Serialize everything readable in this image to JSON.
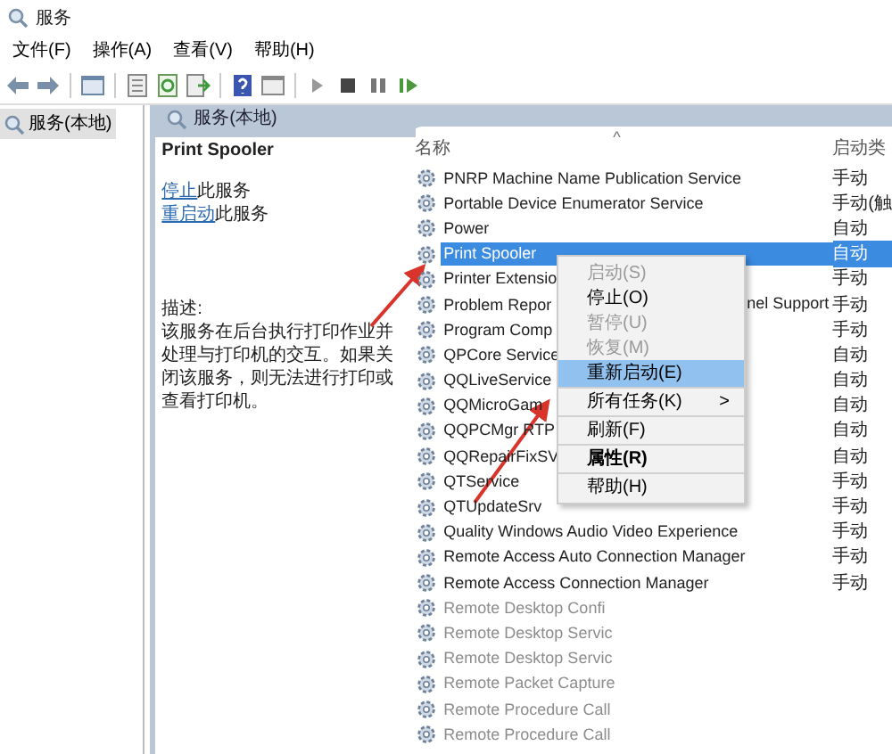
{
  "window": {
    "title": "服务"
  },
  "menu_bar": [
    "文件(F)",
    "操作(A)",
    "查看(V)",
    "帮助(H)"
  ],
  "tree": {
    "items": [
      {
        "label": "服务(本地)",
        "selected": true
      }
    ]
  },
  "panel_header": "服务(本地)",
  "description_pane": {
    "title": "Print Spooler",
    "actions": [
      {
        "link": "停止",
        "text": "此服务"
      },
      {
        "link": "重启动",
        "text": "此服务"
      }
    ],
    "description_label": "描述:",
    "description": "该服务在后台执行打印作业并处理与打印机的交互。如果关闭该服务，则无法进行打印或查看打印机。"
  },
  "table": {
    "sort_indicator": "^",
    "columns": [
      "名称",
      "启动类"
    ],
    "rows": [
      {
        "name": "PNRP Machine Name Publication Service",
        "startup": "手动",
        "selected": false,
        "faded": false
      },
      {
        "name": "Portable Device Enumerator Service",
        "startup": "手动(触",
        "selected": false,
        "faded": false
      },
      {
        "name": "Power",
        "startup": "自动",
        "selected": false,
        "faded": false
      },
      {
        "name": "Print Spooler",
        "startup": "自动",
        "selected": true,
        "faded": false
      },
      {
        "name": "Printer Extensio",
        "startup": "手动",
        "selected": false,
        "faded": false
      },
      {
        "name": "Problem Repor",
        "name_tail": "nel Support",
        "startup": "手动",
        "selected": false,
        "faded": false
      },
      {
        "name": "Program Comp",
        "startup": "手动",
        "selected": false,
        "faded": false
      },
      {
        "name": "QPCore Service",
        "startup": "自动",
        "selected": false,
        "faded": false
      },
      {
        "name": "QQLiveService",
        "startup": "自动",
        "selected": false,
        "faded": false
      },
      {
        "name": "QQMicroGam",
        "startup": "自动",
        "selected": false,
        "faded": false
      },
      {
        "name": "QQPCMgr RTP",
        "startup": "自动",
        "selected": false,
        "faded": false
      },
      {
        "name": "QQRepairFixSV",
        "startup": "自动",
        "selected": false,
        "faded": false
      },
      {
        "name": "QTService",
        "startup": "手动",
        "selected": false,
        "faded": false
      },
      {
        "name": "QTUpdateSrv",
        "startup": "手动",
        "selected": false,
        "faded": false
      },
      {
        "name": "Quality Windows Audio Video Experience",
        "startup": "手动",
        "selected": false,
        "faded": false
      },
      {
        "name": "Remote Access Auto Connection Manager",
        "startup": "手动",
        "selected": false,
        "faded": false
      },
      {
        "name": "Remote Access Connection Manager",
        "startup": "手动",
        "selected": false,
        "faded": false
      },
      {
        "name": "Remote Desktop Confi",
        "selected": false,
        "faded": true
      },
      {
        "name": "Remote Desktop Servic",
        "selected": false,
        "faded": true
      },
      {
        "name": "Remote Desktop Servic",
        "selected": false,
        "faded": true
      },
      {
        "name": "Remote Packet Capture",
        "selected": false,
        "faded": true
      },
      {
        "name": "Remote Procedure Call",
        "selected": false,
        "faded": true
      },
      {
        "name": "Remote Procedure Call",
        "selected": false,
        "faded": true
      }
    ]
  },
  "context_menu": [
    {
      "label": "启动(S)",
      "disabled": true,
      "selected": false,
      "bold": false,
      "separator_after": false
    },
    {
      "label": "停止(O)",
      "disabled": false,
      "selected": false,
      "bold": false,
      "separator_after": false
    },
    {
      "label": "暂停(U)",
      "disabled": true,
      "selected": false,
      "bold": false,
      "separator_after": false
    },
    {
      "label": "恢复(M)",
      "disabled": true,
      "selected": false,
      "bold": false,
      "separator_after": false
    },
    {
      "label": "重新启动(E)",
      "disabled": false,
      "selected": true,
      "bold": false,
      "separator_after": true
    },
    {
      "label": "所有任务(K)",
      "disabled": false,
      "selected": false,
      "bold": false,
      "submenu": ">",
      "separator_after": true
    },
    {
      "label": "刷新(F)",
      "disabled": false,
      "selected": false,
      "bold": false,
      "separator_after": true
    },
    {
      "label": "属性(R)",
      "disabled": false,
      "selected": false,
      "bold": true,
      "separator_after": true
    },
    {
      "label": "帮助(H)",
      "disabled": false,
      "selected": false,
      "bold": false,
      "separator_after": false
    }
  ]
}
